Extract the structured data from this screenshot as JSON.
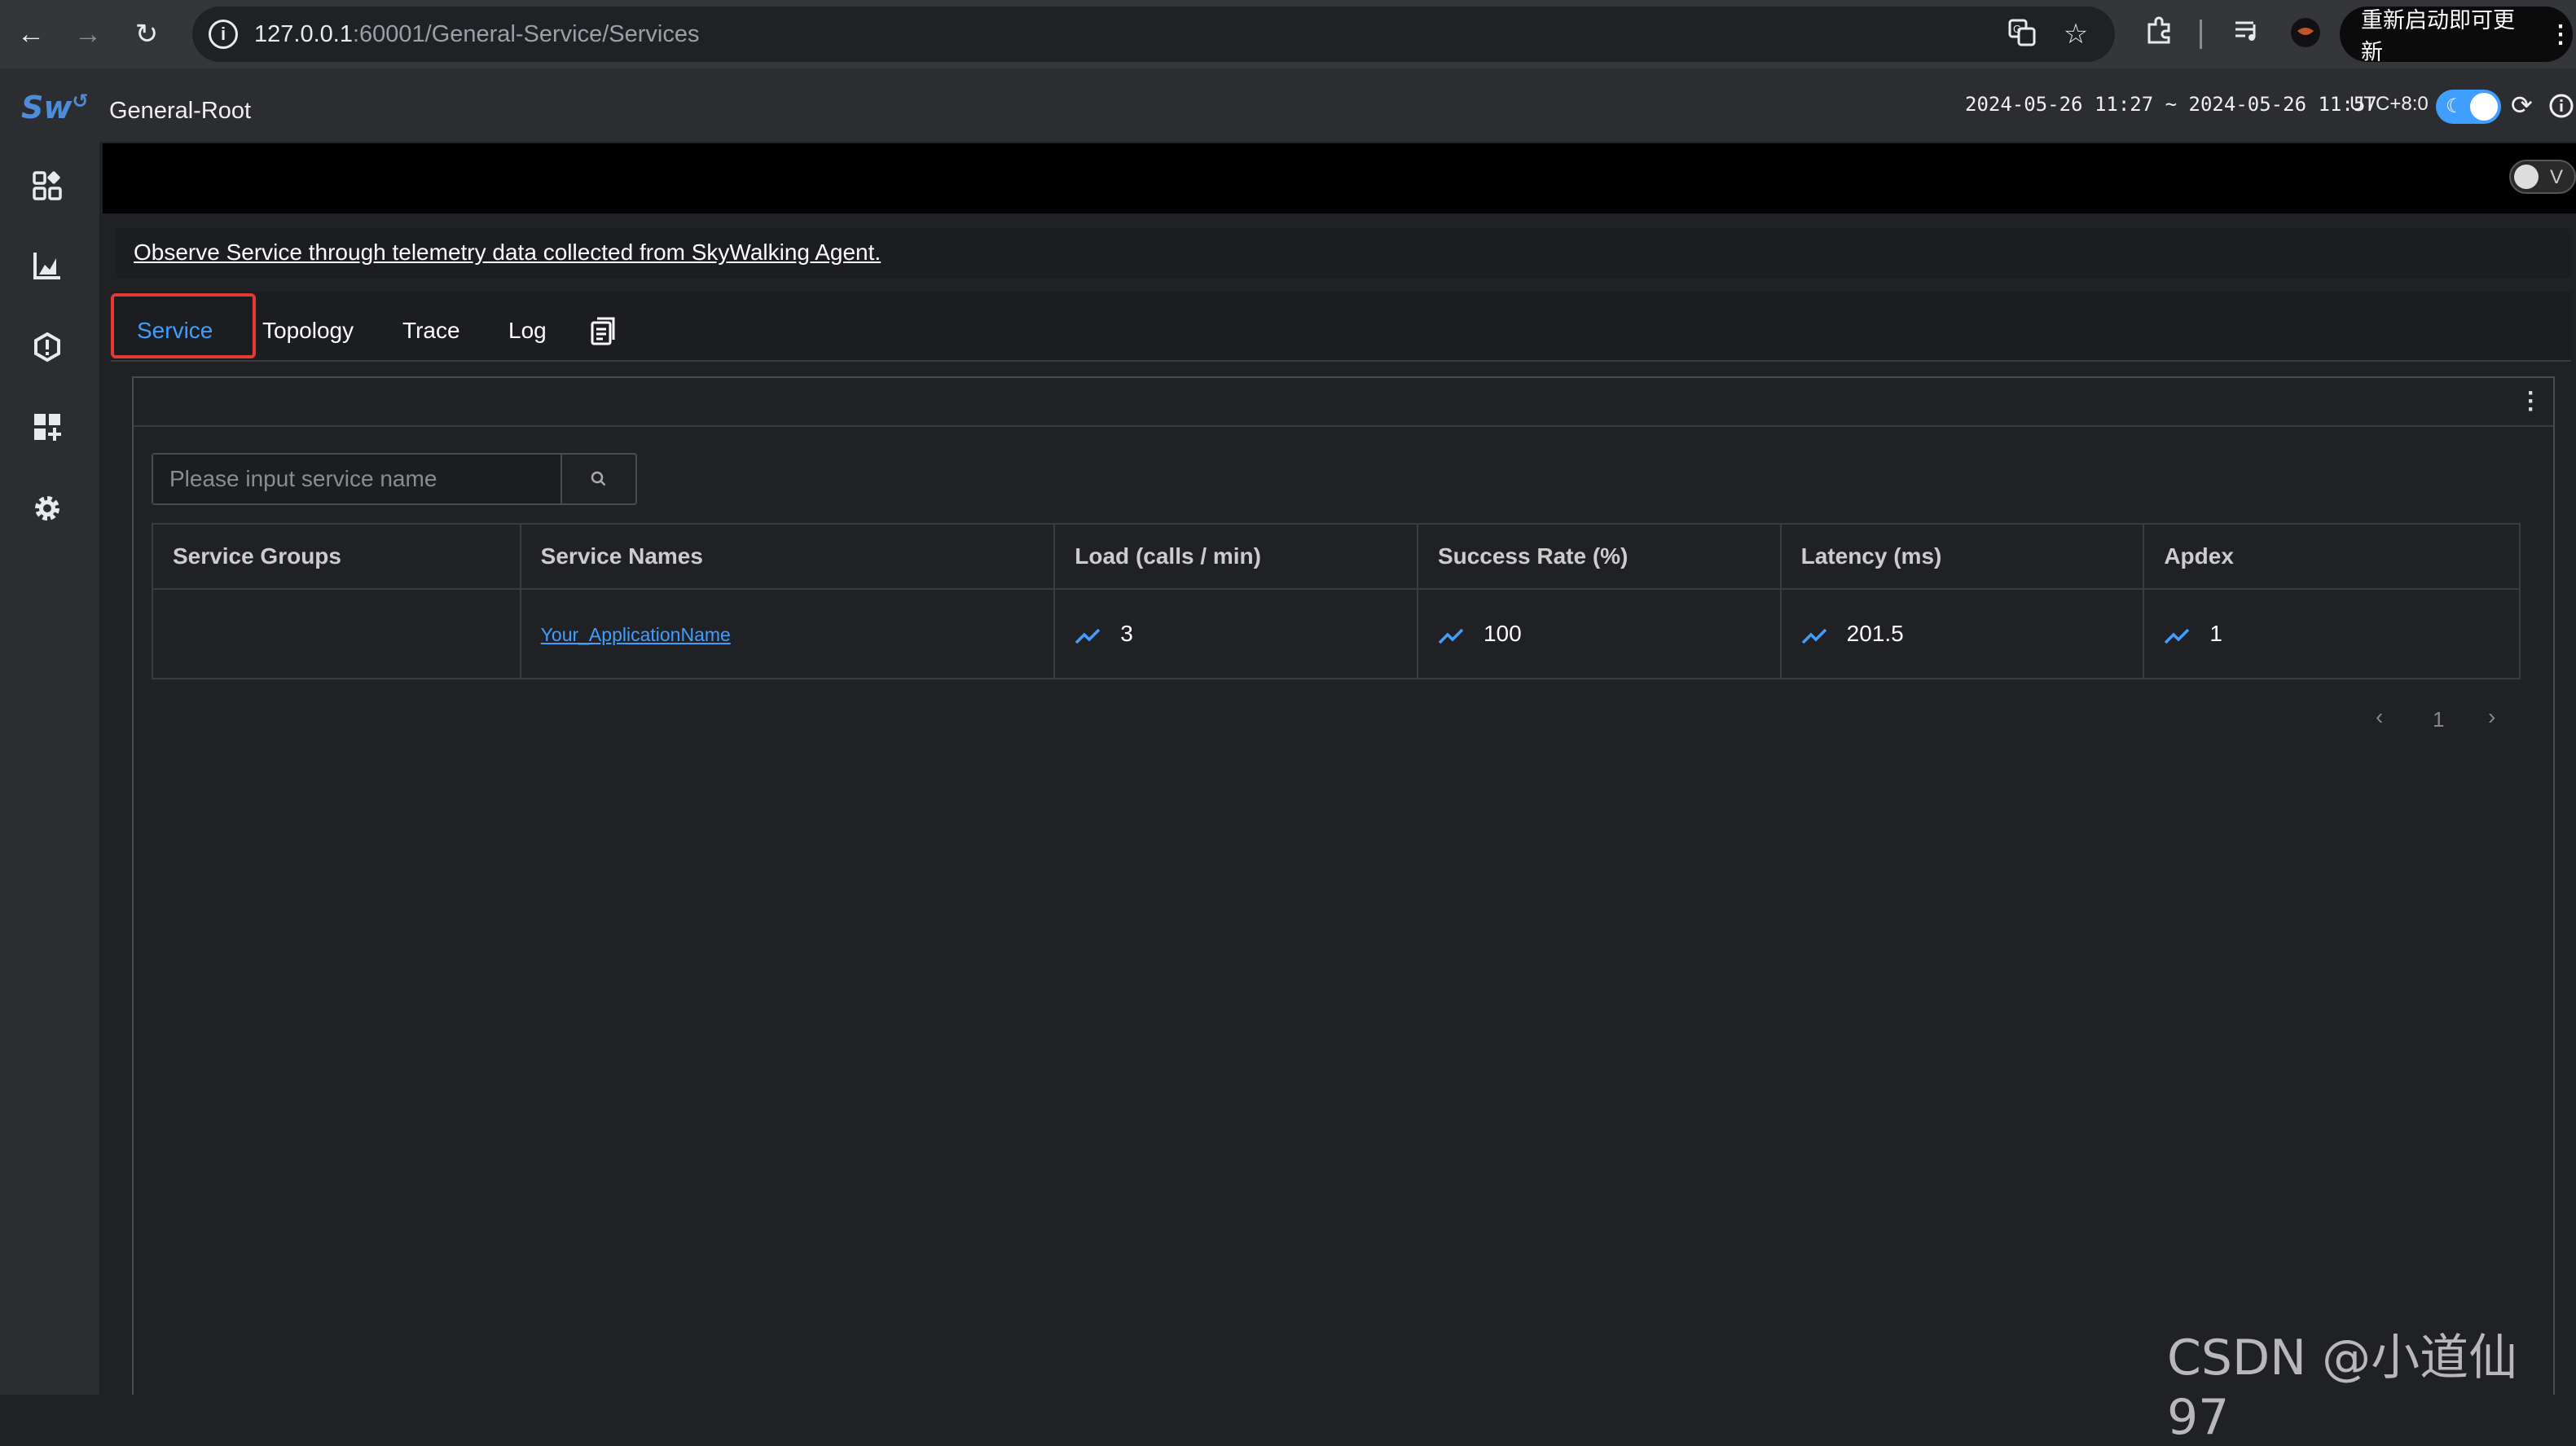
{
  "browser": {
    "url_host": "127.0.0.1",
    "url_path": ":60001/General-Service/Services",
    "update_label": "重新启动即可更新"
  },
  "header": {
    "title": "General-Root",
    "time_range": "2024-05-26 11:27 ~ 2024-05-26 11:57",
    "timezone": "UTC+8:0",
    "v_toggle_label": "V"
  },
  "description": "Observe Service through telemetry data collected from SkyWalking Agent.",
  "tabs": [
    {
      "label": "Service",
      "active": true
    },
    {
      "label": "Topology"
    },
    {
      "label": "Trace"
    },
    {
      "label": "Log"
    }
  ],
  "search": {
    "placeholder": "Please input service name"
  },
  "table": {
    "headers": [
      "Service Groups",
      "Service Names",
      "Load (calls / min)",
      "Success Rate (%)",
      "Latency (ms)",
      "Apdex"
    ],
    "rows": [
      {
        "group": "",
        "name": "Your_ApplicationName",
        "load": "3",
        "success_rate": "100",
        "latency": "201.5",
        "apdex": "1"
      }
    ]
  },
  "pagination": {
    "current_page": "1"
  },
  "watermark": "CSDN @小道仙97",
  "colors": {
    "accent": "#409eff",
    "highlight": "#e53935",
    "background": "#202124"
  }
}
